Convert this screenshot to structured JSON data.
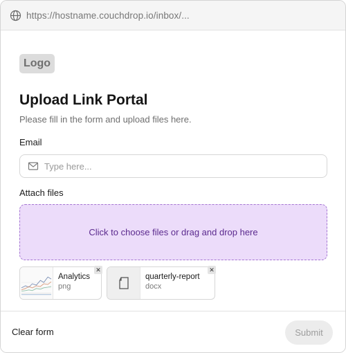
{
  "browser": {
    "url": "https://hostname.couchdrop.io/inbox/..."
  },
  "logo": {
    "text": "Logo"
  },
  "header": {
    "title": "Upload Link Portal",
    "subtitle": "Please fill in the form and upload files here."
  },
  "form": {
    "email_label": "Email",
    "email_value": "",
    "email_placeholder": "Type here...",
    "attach_label": "Attach files",
    "dropzone_text": "Click to choose files or drag and drop here"
  },
  "files": [
    {
      "name": "Analytics",
      "type": "png",
      "thumbnail": "line-chart-thumbnail"
    },
    {
      "name": "quarterly-report",
      "type": "docx",
      "thumbnail": "document-icon"
    }
  ],
  "footer": {
    "clear_label": "Clear form",
    "submit_label": "Submit"
  },
  "colors": {
    "dropzone_bg": "#ecdcfa",
    "dropzone_border": "#a474d2",
    "dropzone_text": "#5b2a8e",
    "submit_disabled_bg": "#ececec"
  }
}
